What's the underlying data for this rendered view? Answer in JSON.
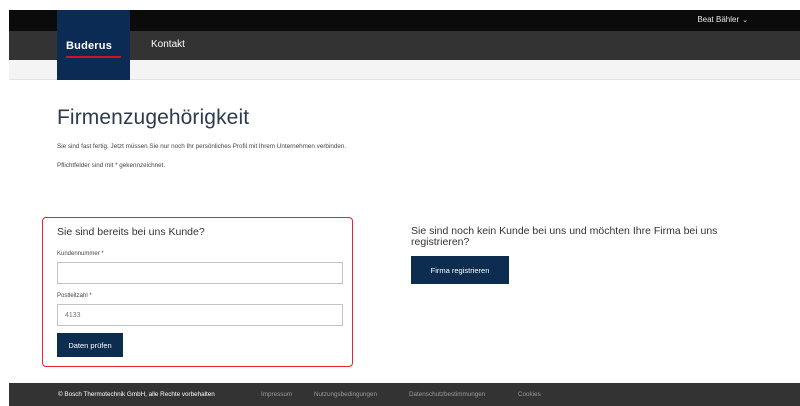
{
  "header": {
    "user_name": "Beat Bähler",
    "user_chevron_icon": "chevron-down-icon",
    "nav_contact": "Kontakt",
    "logo": "Buderus",
    "logo_accent_color": "#d4111e",
    "brand_color": "#0b2b55"
  },
  "main": {
    "title": "Firmenzugehörigkeit",
    "intro": "Sie sind fast fertig. Jetzt müssen Sie nur noch Ihr persönliches Profil mit Ihrem Unternehmen verbinden.",
    "required_note": "Pflichtfelder sind mit * gekennzeichnet."
  },
  "existing_customer": {
    "heading": "Sie sind bereits bei uns Kunde?",
    "customer_number_label": "Kundennummer *",
    "customer_number_value": "",
    "postal_code_label": "Postleitzahl *",
    "postal_code_placeholder": "4133",
    "submit_label": "Daten prüfen",
    "highlight_color": "#e6262e"
  },
  "new_customer": {
    "heading": "Sie sind noch kein Kunde bei uns und möchten Ihre Firma bei uns registrieren?",
    "register_label": "Firma registrieren"
  },
  "footer": {
    "copyright": "© Bosch Thermotechnik GmbH, alle Rechte vorbehalten",
    "links": [
      "Impressum",
      "Nutzungsbedingungen",
      "Datenschutzbestimmungen",
      "Cookies"
    ]
  }
}
